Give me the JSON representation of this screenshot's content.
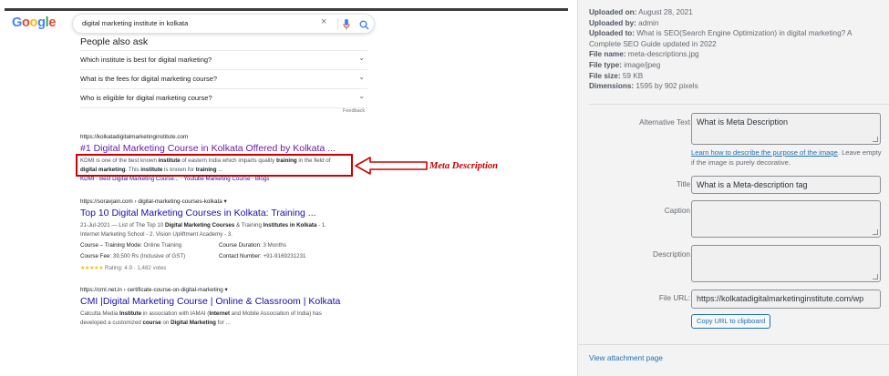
{
  "google": {
    "logo_letters": [
      {
        "ch": "G",
        "color": "#4285f4"
      },
      {
        "ch": "o",
        "color": "#ea4335"
      },
      {
        "ch": "o",
        "color": "#fbbc05"
      },
      {
        "ch": "g",
        "color": "#4285f4"
      },
      {
        "ch": "l",
        "color": "#34a853"
      },
      {
        "ch": "e",
        "color": "#ea4335"
      }
    ],
    "query": "digital marketing institute in kolkata",
    "clear_icon": "×",
    "paa_title": "People also ask",
    "paa": [
      "Which institute is best for digital marketing?",
      "What is the fees for digital marketing course?",
      "Who is eligible for digital marketing course?"
    ],
    "feedback": "Feedback",
    "results": [
      {
        "url": "https://kolkatadigitalmarketinginstitute.com",
        "title": "#1 Digital Marketing Course in Kolkata Offered by Kolkata ...",
        "snippet_html": "KDMI is one of the best known <b>institute</b> of eastern India which imparts quality <b>training</b> in the field of <b>digital marketing</b>. This <b>institute</b> is known for <b>training</b> ...",
        "links": "KDMI · Best Digital Marketing Course... · Youtube Marketing Course · Blogs"
      },
      {
        "url": "https://soravjain.com › digital-marketing-courses-kolkata ▾",
        "title": "Top 10 Digital Marketing Courses in Kolkata: Training ...",
        "snippet_html": "21-Jul-2021 — List of The Top 10 <b>Digital Marketing Courses</b> &amp; Training <b>Institutes in Kolkata</b> - 1. Internet Marketing School - 2. Vision Upliftment Academy - 3.",
        "attrs": [
          {
            "k": "Course – Training Mode:",
            "v": " Online Training"
          },
          {
            "k": "Course Duration:",
            "v": " 3 Months"
          },
          {
            "k": "Course Fee:",
            "v": " 39,500 Rs (Inclusive of GST)"
          },
          {
            "k": "Contact Number:",
            "v": " +91-9169231231"
          }
        ],
        "stars": "★★★★★",
        "rating": " Rating: 4.9 · 1,482 votes"
      },
      {
        "url": "https://cml.net.in › certificate-course-on-digital-marketing ▾",
        "title": "CMI |Digital Marketing Course | Online & Classroom | Kolkata",
        "snippet_html": "Calcutta Media <b>Institute</b> in association with IAMAI (<b>Internet</b> and Mobile Association of India) has developed a customized <b>course</b> on <b>Digital Marketing</b> for ..."
      }
    ],
    "annotation": "Meta Description"
  },
  "details": {
    "meta": [
      {
        "k": "Uploaded on:",
        "v": " August 28, 2021"
      },
      {
        "k": "Uploaded by:",
        "v": " admin"
      },
      {
        "k": "Uploaded to:",
        "v": " What is SEO(Search Engine Optimization) in digital marketing? A Complete SEO Guide updated in 2022"
      },
      {
        "k": "File name:",
        "v": " meta-descriptions.jpg"
      },
      {
        "k": "File type:",
        "v": " image/jpeg"
      },
      {
        "k": "File size:",
        "v": " 59 KB"
      },
      {
        "k": "Dimensions:",
        "v": " 1595 by 902 pixels"
      }
    ],
    "alt_label": "Alternative Text",
    "alt_value": "What is Meta Description",
    "help_link": "Learn how to describe the purpose of the image",
    "help_text": ". Leave empty if the image is purely decorative.",
    "title_label": "Title",
    "title_value": "What is a Meta-description tag",
    "caption_label": "Caption",
    "caption_value": "",
    "description_label": "Description",
    "description_value": "",
    "url_label": "File URL:",
    "url_value": "https://kolkatadigitalmarketinginstitute.com/wp",
    "copy_button": "Copy URL to clipboard",
    "view_link": "View attachment page"
  }
}
